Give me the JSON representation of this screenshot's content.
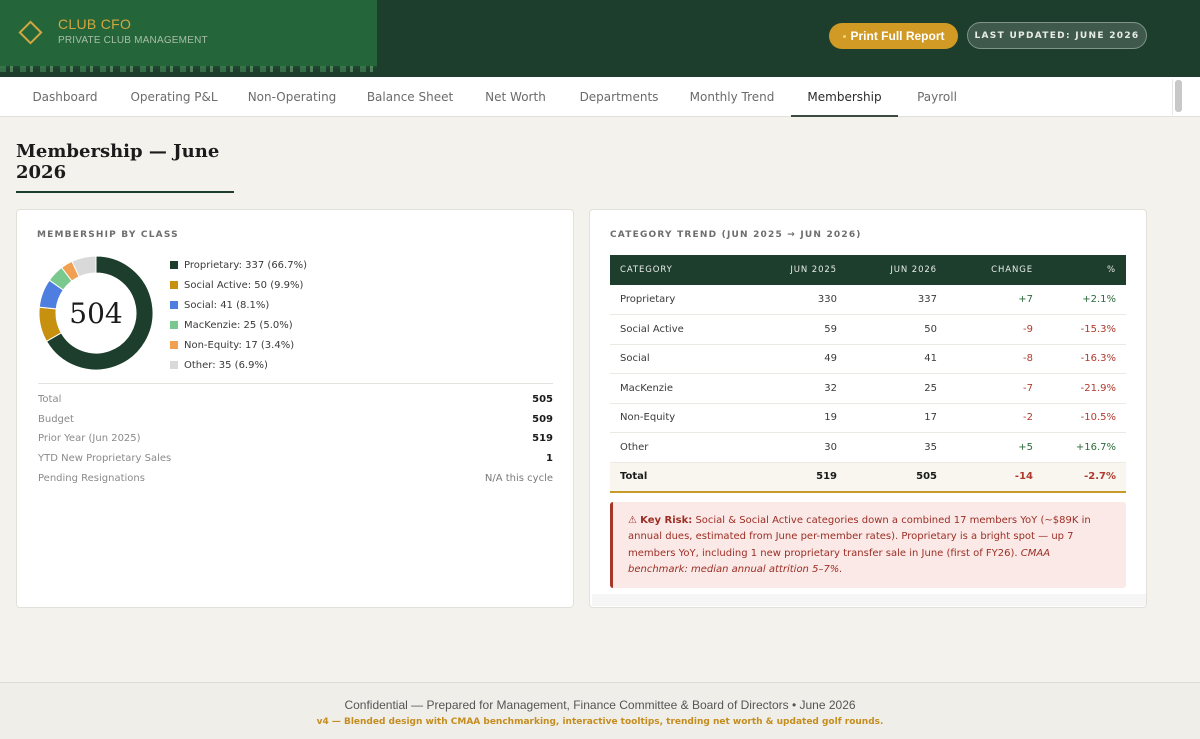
{
  "app": {
    "title": "CLUB CFO",
    "subtitle": "PRIVATE CLUB MANAGEMENT",
    "print_label": "Print Full Report",
    "updated_label": "LAST UPDATED: JUNE 2026",
    "accent": "#d09a25",
    "brand_green": "#1d3e2c"
  },
  "tabs": [
    {
      "label": "Dashboard"
    },
    {
      "label": "Operating P&L"
    },
    {
      "label": "Non-Operating"
    },
    {
      "label": "Balance Sheet"
    },
    {
      "label": "Net Worth"
    },
    {
      "label": "Departments"
    },
    {
      "label": "Monthly Trend"
    },
    {
      "label": "Membership",
      "active": true
    },
    {
      "label": "Payroll"
    }
  ],
  "page": {
    "title": "Membership — June 2026"
  },
  "membership_by_class": {
    "label": "MEMBERSHIP BY CLASS",
    "center_value": "504",
    "legend": [
      {
        "label": "Proprietary: 337 (66.7%)",
        "value": 337,
        "color": "#1d3e2c"
      },
      {
        "label": "Social Active: 50 (9.9%)",
        "value": 50,
        "color": "#c8900f"
      },
      {
        "label": "Social: 41 (8.1%)",
        "value": 41,
        "color": "#4e7fe0"
      },
      {
        "label": "MacKenzie: 25 (5.0%)",
        "value": 25,
        "color": "#79c98f"
      },
      {
        "label": "Non-Equity: 17 (3.4%)",
        "value": 17,
        "color": "#f0a050"
      },
      {
        "label": "Other: 35 (6.9%)",
        "value": 35,
        "color": "#d9d9d9"
      }
    ],
    "stats": [
      {
        "label": "Total",
        "value": "505"
      },
      {
        "label": "Budget",
        "value": "509"
      },
      {
        "label": "Prior Year (Jun 2025)",
        "value": "519"
      },
      {
        "label": "YTD New Proprietary Sales",
        "value": "1"
      },
      {
        "label": "Pending Resignations",
        "value": "N/A this cycle",
        "muted": true
      }
    ]
  },
  "category_trend": {
    "label": "CATEGORY TREND (JUN 2025 → JUN 2026)",
    "columns": [
      "CATEGORY",
      "JUN 2025",
      "JUN 2026",
      "CHANGE",
      "%"
    ],
    "rows": [
      {
        "category": "Proprietary",
        "jun2025": "330",
        "jun2026": "337",
        "change": "+7",
        "pct": "+2.1%"
      },
      {
        "category": "Social Active",
        "jun2025": "59",
        "jun2026": "50",
        "change": "-9",
        "pct": "-15.3%"
      },
      {
        "category": "Social",
        "jun2025": "49",
        "jun2026": "41",
        "change": "-8",
        "pct": "-16.3%"
      },
      {
        "category": "MacKenzie",
        "jun2025": "32",
        "jun2026": "25",
        "change": "-7",
        "pct": "-21.9%"
      },
      {
        "category": "Non-Equity",
        "jun2025": "19",
        "jun2026": "17",
        "change": "-2",
        "pct": "-10.5%"
      },
      {
        "category": "Other",
        "jun2025": "30",
        "jun2026": "35",
        "change": "+5",
        "pct": "+16.7%"
      }
    ],
    "total": {
      "category": "Total",
      "jun2025": "519",
      "jun2026": "505",
      "change": "-14",
      "pct": "-2.7%"
    }
  },
  "risk": {
    "icon": "⚠",
    "heading": "Key Risk:",
    "body": "Social & Social Active categories down a combined 17 members YoY (~$89K in annual dues, estimated from June per-member rates). Proprietary is a bright spot — up 7 members YoY, including 1 new proprietary transfer sale in June (first of FY26).",
    "benchmark": "CMAA benchmark: median annual attrition 5–7%."
  },
  "footer": {
    "main": "Confidential — Prepared for Management, Finance Committee & Board of Directors • June 2026",
    "note": "v4 — Blended design with CMAA benchmarking, interactive tooltips, trending net worth & updated golf rounds."
  }
}
